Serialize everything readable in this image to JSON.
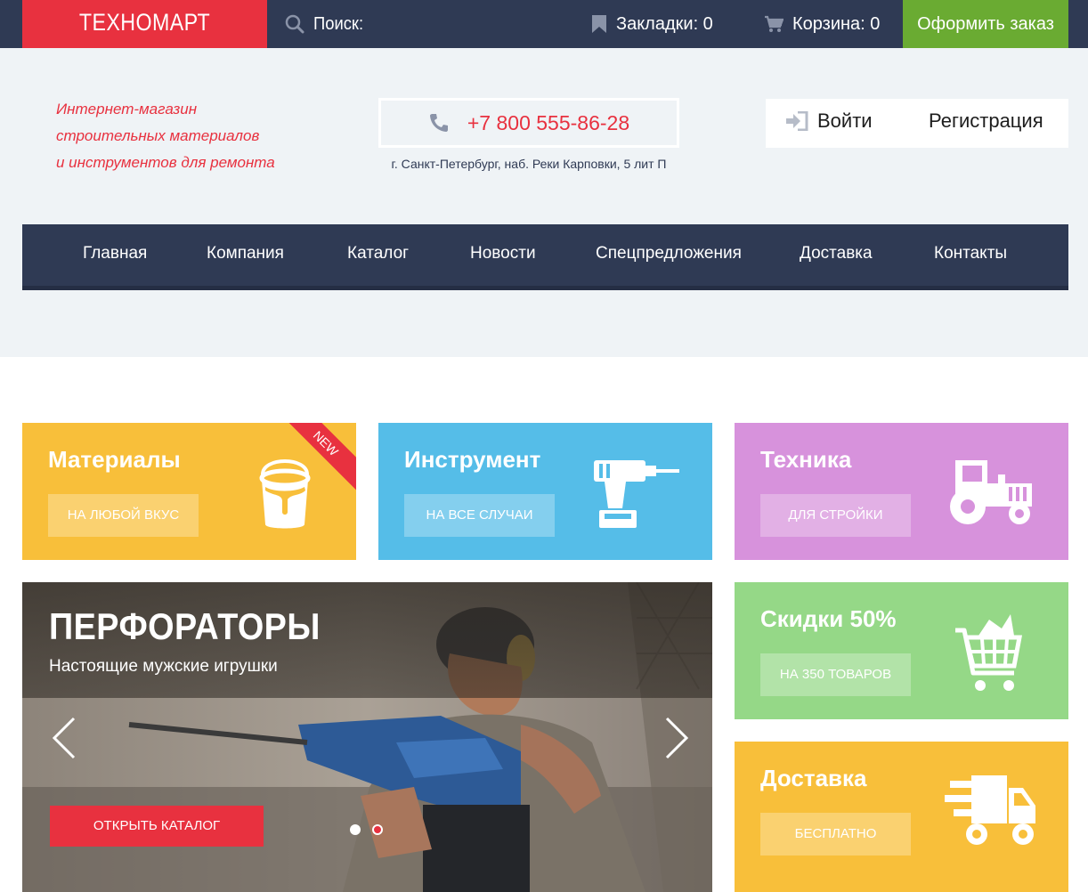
{
  "topbar": {
    "logo": "ТЕХНОМАРТ",
    "search_label": "Поиск:",
    "bookmarks_label": "Закладки: 0",
    "cart_label": "Корзина: 0",
    "order_button": "Оформить заказ"
  },
  "header": {
    "tagline": [
      "Интернет-магазин",
      "строительных материалов",
      "и инструментов для ремонта"
    ],
    "phone": "+7 800 555-86-28",
    "address": "г. Санкт-Петербург, наб. Реки Карповки, 5 лит П",
    "login": "Войти",
    "register": "Регистрация"
  },
  "nav": {
    "items": [
      "Главная",
      "Компания",
      "Каталог",
      "Новости",
      "Спецпредложения",
      "Доставка",
      "Контакты"
    ]
  },
  "tiles": {
    "materials": {
      "title": "Материалы",
      "button": "НА ЛЮБОЙ ВКУС",
      "badge": "NEW",
      "icon": "paint-bucket-icon"
    },
    "tools": {
      "title": "Инструмент",
      "button": "НА ВСЕ СЛУЧАИ",
      "icon": "drill-icon"
    },
    "machinery": {
      "title": "Техника",
      "button": "ДЛЯ СТРОЙКИ",
      "icon": "tractor-icon"
    },
    "discount": {
      "title": "Скидки 50%",
      "button": "НА 350 ТОВАРОВ",
      "icon": "cart-icon"
    },
    "delivery": {
      "title": "Доставка",
      "button": "БЕСПЛАТНО",
      "icon": "truck-icon"
    }
  },
  "slider": {
    "title": "ПЕРФОРАТОРЫ",
    "subtitle": "Настоящие мужские игрушки",
    "button": "ОТКРЫТЬ КАТАЛОГ",
    "slides": 2,
    "active_slide": 2
  },
  "colors": {
    "dark": "#2f3a54",
    "red": "#e8313f",
    "green": "#6aab32",
    "yellow": "#f8bf3a",
    "blue": "#55bde8",
    "purple": "#d792dc",
    "light_green": "#95d887"
  }
}
